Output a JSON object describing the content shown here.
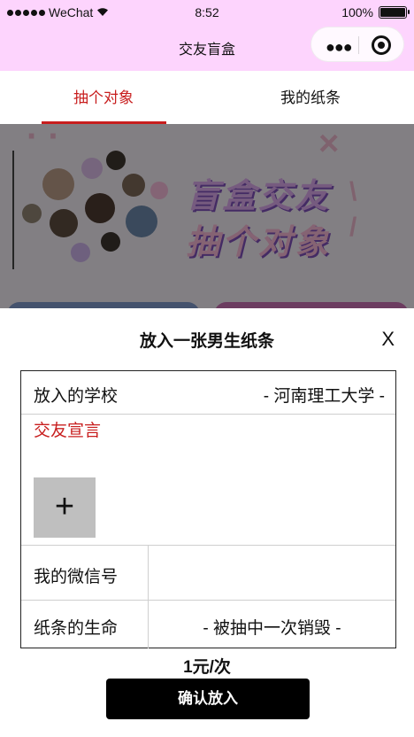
{
  "status_bar": {
    "carrier": "WeChat",
    "time": "8:52",
    "battery": "100%",
    "battery_level": 1.0
  },
  "nav": {
    "title": "交友盲盒",
    "more_icon": "more-dots-icon",
    "close_icon": "target-close-icon"
  },
  "tabs": [
    {
      "label": "抽个对象",
      "active": true
    },
    {
      "label": "我的纸条",
      "active": false
    }
  ],
  "banner": {
    "line1": "盲盒交友",
    "line2": "抽个对象"
  },
  "sheet": {
    "title": "放入一张男生纸条",
    "close_label": "X",
    "school_label": "放入的学校",
    "school_value": "- 河南理工大学 -",
    "declaration_label": "交友宣言",
    "upload_icon": "+",
    "wechat_label": "我的微信号",
    "wechat_value": "",
    "life_label": "纸条的生命",
    "life_value": "- 被抽中一次销毁 -",
    "price": "1元/次",
    "confirm_label": "确认放入"
  },
  "colors": {
    "nav_bg": "#fdd4fd",
    "accent_red": "#c81e1e",
    "confirm_bg": "#000000"
  }
}
